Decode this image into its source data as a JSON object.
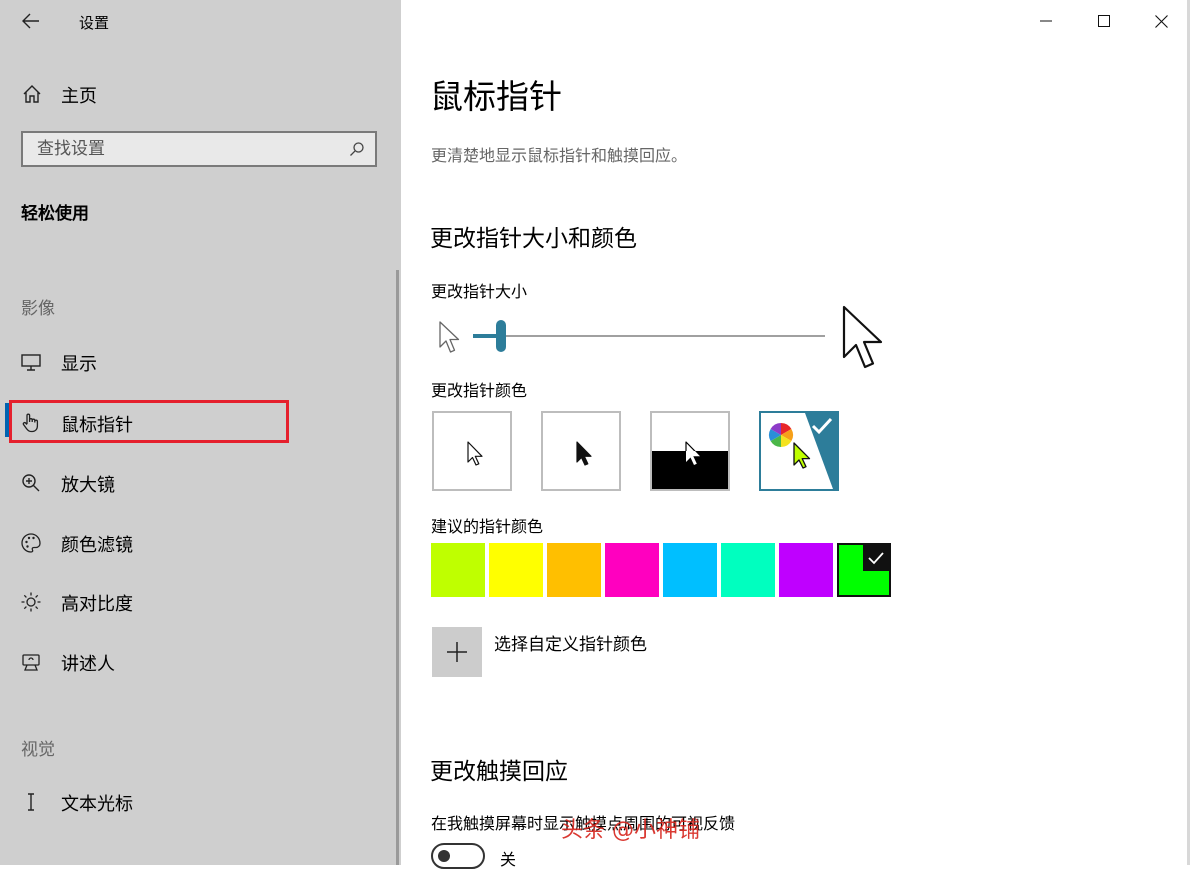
{
  "window": {
    "title": "设置"
  },
  "sidebar": {
    "home_label": "主页",
    "search_placeholder": "查找设置",
    "section_title": "轻松使用",
    "groups": {
      "vision": "影像",
      "hearing": "视觉"
    },
    "items": [
      {
        "label": "显示",
        "icon": "monitor-icon"
      },
      {
        "label": "鼠标指针",
        "icon": "hand-pointer-icon",
        "selected": true
      },
      {
        "label": "放大镜",
        "icon": "magnifier-icon"
      },
      {
        "label": "颜色滤镜",
        "icon": "palette-icon"
      },
      {
        "label": "高对比度",
        "icon": "brightness-icon"
      },
      {
        "label": "讲述人",
        "icon": "narrator-icon"
      },
      {
        "label": "文本光标",
        "icon": "text-cursor-icon"
      }
    ],
    "highlight_color": "#e5202d"
  },
  "main": {
    "page_title": "鼠标指针",
    "page_description": "更清楚地显示鼠标指针和触摸回应。",
    "size_color_section": {
      "heading": "更改指针大小和颜色",
      "size_label": "更改指针大小",
      "size_level": 0.08,
      "color_label": "更改指针颜色",
      "color_options": [
        "white",
        "black",
        "inverted",
        "custom"
      ],
      "selected_color_option": "custom",
      "suggested_label": "建议的指针颜色",
      "suggested_colors": [
        "#bfff00",
        "#ffff00",
        "#ffbf00",
        "#ff00bf",
        "#00bfff",
        "#00ffbf",
        "#bf00ff",
        "#00ff00"
      ],
      "selected_suggested_index": 7,
      "custom_color_label": "选择自定义指针颜色"
    },
    "touch_section": {
      "heading": "更改触摸回应",
      "description": "在我触摸屏幕时显示触摸点周围的可视反馈",
      "toggle_state": "关"
    }
  },
  "watermark": "头条 @小神铺",
  "accent_color": "#2d7d9a"
}
